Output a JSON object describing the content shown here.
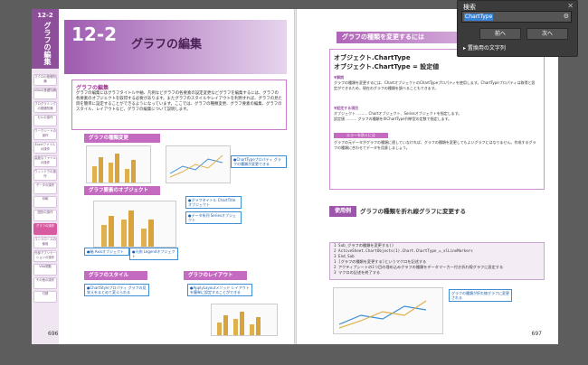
{
  "search_panel": {
    "title": "検索",
    "query": "ChartType",
    "prev_label": "前へ",
    "next_label": "次へ",
    "special_chars_label": "▸ 置換用の文字列"
  },
  "left_page": {
    "side_num": "12-2",
    "side_title": "グラフの編集",
    "chapter_items": [
      "マクロの基礎知識",
      "VBAの基礎知識",
      "プログラミングの基礎知識",
      "セルの操作",
      "ワークシートの操作",
      "Excelファイルの操作",
      "高度なファイルの操作",
      "ウィンドウの操作",
      "データの操作",
      "印刷",
      "図形の操作",
      "グラフの操作",
      "コントロールの使用",
      "外部アプリケーションの操作",
      "VBA関数",
      "その他の操作",
      "付録"
    ],
    "active_index": 11,
    "banner_num": "12-2",
    "banner_title": "グラフの編集",
    "lead_title": "グラフの編集",
    "lead_text": "グラフの編集にはグラフタイトルや軸、凡例などグラフの各要素の設定変更などグラフを編集するには、グラフの各要素のオブジェクトを取得する必要があります。またグラフのスタイルやレイアウトを利用すれば、グラフの見た目を簡単に設定することができるようになっています。ここでは、グラフの種類変更、グラフ要素の編集、グラフのスタイル、レイアウトなど、グラフの編集について説明します。",
    "sub1": "グラフの種類変更",
    "sub2": "グラフ要素のオブジェクト",
    "sub3": "グラフのスタイル",
    "sub4": "グラフのレイアウト",
    "callout_charttype": "●ChartTypeプロパティ グラフの種類が変更できる",
    "callout_title": "●グラフタイトル ChartTitleオブジェクト",
    "callout_series": "●データ系列 Seriesオブジェクト",
    "callout_axis": "●軸 Axisオブジェクト",
    "callout_legend": "●凡例 Legendオブジェクト",
    "callout_style": "●ChartStyleプロパティ グラフの見栄えをまとめて変えられる",
    "callout_layout": "●ApplyLayoutメソッド レイアウトを簡単に設定することができる",
    "page_number": "696"
  },
  "right_page": {
    "heading": "グラフの種類を変更するには",
    "syntax_line1": "オブジェクト.ChartType",
    "syntax_line2": "オブジェクト.ChartType = 設定値",
    "syntax_suffix": "取得 / 設定",
    "explain_label": "▼解説",
    "explain_text": "グラフの種類を変更するには、ChartオブジェクトのChartTypeプロパティを使用します。ChartTypeプロパティは取得と設定ができるため、現在のグラフの種類を調べることもできます。",
    "settings_label": "▼設定する項目",
    "settings_object": "オブジェクト ……… Chartオブジェクト、Seriesオブジェクトを指定します。",
    "settings_value": "設定値 ……… グラフの種類をXlChartType列挙型の定数で指定します。",
    "error_label": "エラーを防ぐには",
    "error_text": "グラフの元データがグラフの種類に適していなければ、グラフの種類を変更してもよいグラフにはなりません。作成するグラフの種類に合わせてデータを用意しましょう。",
    "example_label": "使用例",
    "example_title": "グラフの種類を折れ線グラフに変更する",
    "code_lines": [
      "1  Sub_グラフの種類を変更する()",
      "2      ActiveSheet.ChartObjects(1).Chart.ChartType_=_xlLineMarkers",
      "3  End_Sub",
      "1 [グラフの種類を変更する]というマクロを記述する",
      "2 アクティブシートの1つ目の埋め込みグラフの種類をデータマーカー付き折れ線グラフに設定する",
      "3 マクロの記述を終了する"
    ],
    "result_callout": "グラフの種類が折れ線グラフに変更される",
    "page_number": "697"
  },
  "colors": {
    "accent": "#9f5bb0",
    "highlight": "#3a82d6",
    "callout": "#3d8ed5"
  }
}
